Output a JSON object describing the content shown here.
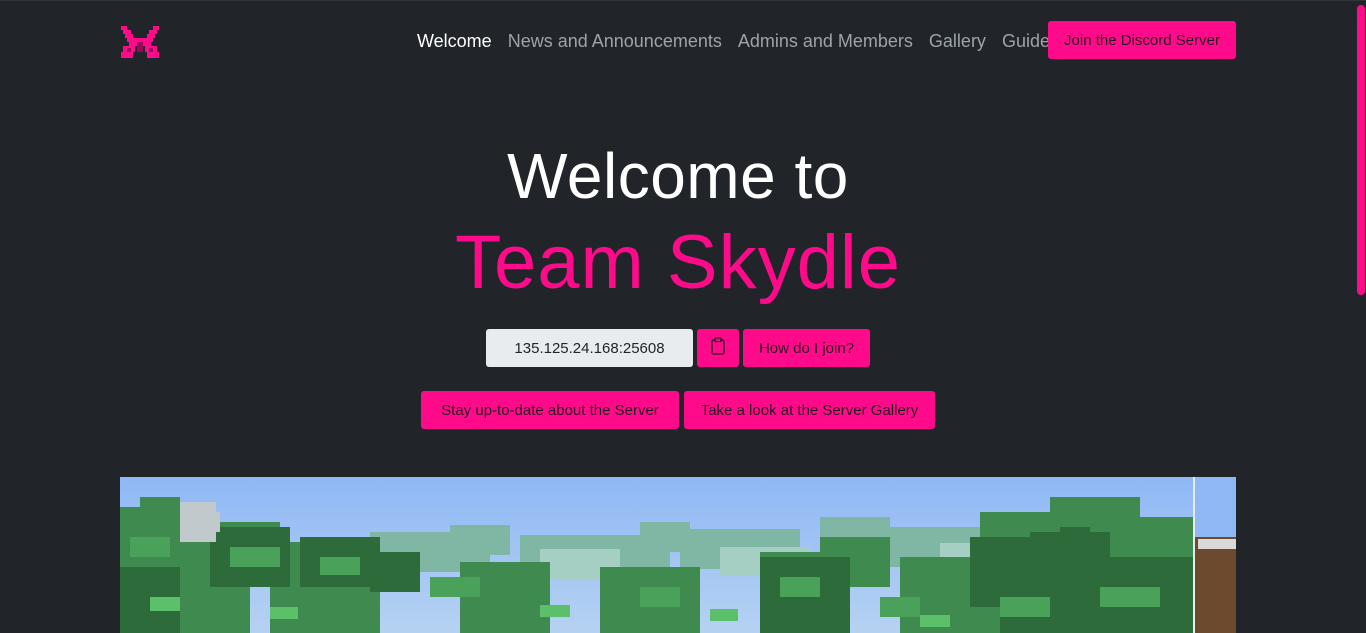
{
  "brand": {
    "logo_icon": "butterfly-logo-icon",
    "accent_color": "#ff0a8a"
  },
  "nav": {
    "items": [
      {
        "label": "Welcome",
        "active": true
      },
      {
        "label": "News and Announcements",
        "active": false
      },
      {
        "label": "Admins and Members",
        "active": false
      },
      {
        "label": "Gallery",
        "active": false
      },
      {
        "label": "Guides",
        "active": false
      }
    ],
    "cta_label": "Join the Discord Server"
  },
  "hero": {
    "line1": "Welcome to",
    "line2": "Team Skydle"
  },
  "server": {
    "address": "135.125.24.168:25608",
    "copy_icon": "clipboard-icon",
    "howto_label": "How do I join?"
  },
  "actions": {
    "news_label": "Stay up-to-date about the Server",
    "gallery_label": "Take a look at the Server Gallery"
  }
}
